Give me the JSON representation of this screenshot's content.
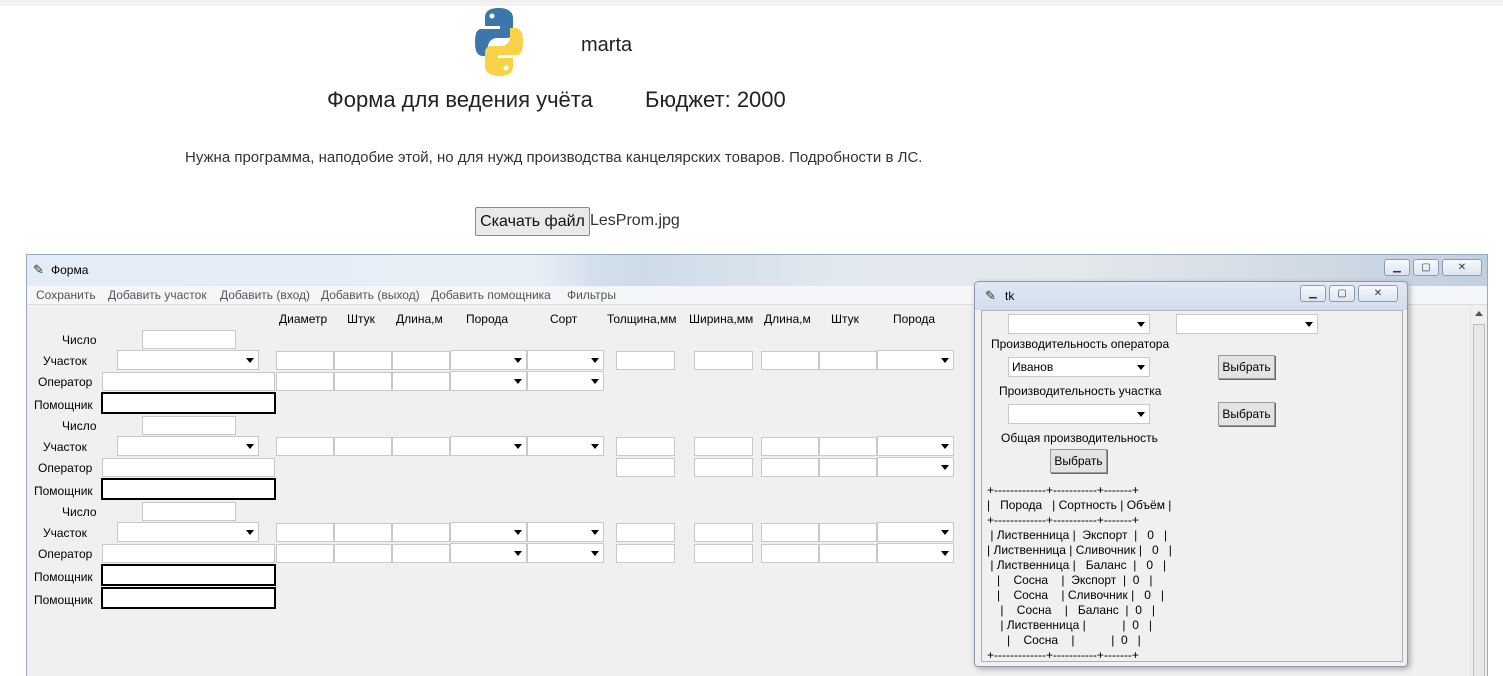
{
  "page": {
    "username": "marta",
    "form_title": "Форма для ведения учёта",
    "budget": "Бюджет: 2000",
    "description": "Нужна программа, наподобие этой, но для нужд производства канцелярских товаров. Подробности в ЛС.",
    "download_button": "Скачать файл",
    "file_name": "LesProm.jpg",
    "logo_icon": "python-logo-icon"
  },
  "main_window": {
    "title": "Форма",
    "menu": [
      "Сохранить",
      "Добавить участок",
      "Добавить (вход)",
      "Добавить (выход)",
      "Добавить помощника",
      "Фильтры"
    ],
    "columns": [
      "Диаметр",
      "Штук",
      "Длина,м",
      "Порода",
      "Сорт",
      "Толщина,мм",
      "Ширина,мм",
      "Длина,м",
      "Штук",
      "Порода"
    ],
    "labels": {
      "number": "Число",
      "section": "Участок",
      "operator": "Оператор",
      "helper": "Помощник"
    }
  },
  "tk_window": {
    "title": "tk",
    "operator_productivity": "Производительность оператора",
    "operator_value": "Иванов",
    "section_productivity": "Производительность участка",
    "total_productivity": "Общая производительность",
    "select_button": "Выбрать",
    "table_text": "+-------------+-----------+-------+\n|   Порода   | Сортность | Объём |\n+-------------+-----------+-------+\n | Лиственница |  Экспорт  |   0   |\n| Лиственница | Сливочник |   0   |\n | Лиственница |   Баланс  |   0   |\n   |    Сосна    |  Экспорт  |  0   |\n   |    Сосна    | Сливочник |   0   |\n    |    Сосна    |   Баланс  |  0   |\n    | Лиственница |           |  0   |\n      |    Сосна    |           |  0   |\n+-------------+-----------+-------+"
  }
}
